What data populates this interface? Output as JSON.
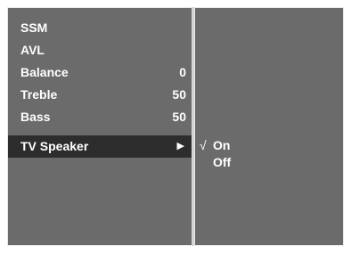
{
  "audio_menu": {
    "items": [
      {
        "label": "SSM",
        "value": ""
      },
      {
        "label": "AVL",
        "value": ""
      },
      {
        "label": "Balance",
        "value": "0"
      },
      {
        "label": "Treble",
        "value": "50"
      },
      {
        "label": "Bass",
        "value": "50"
      }
    ],
    "selected_item": {
      "label": "TV Speaker",
      "arrow": "▶"
    }
  },
  "tv_speaker_submenu": {
    "options": [
      {
        "label": "On",
        "check": "√",
        "checked": true
      },
      {
        "label": "Off",
        "check": "",
        "checked": false
      }
    ]
  },
  "colors": {
    "panel_bg": "#6b6b6b",
    "selected_bg": "#2d2d2d",
    "text": "#ffffff"
  }
}
